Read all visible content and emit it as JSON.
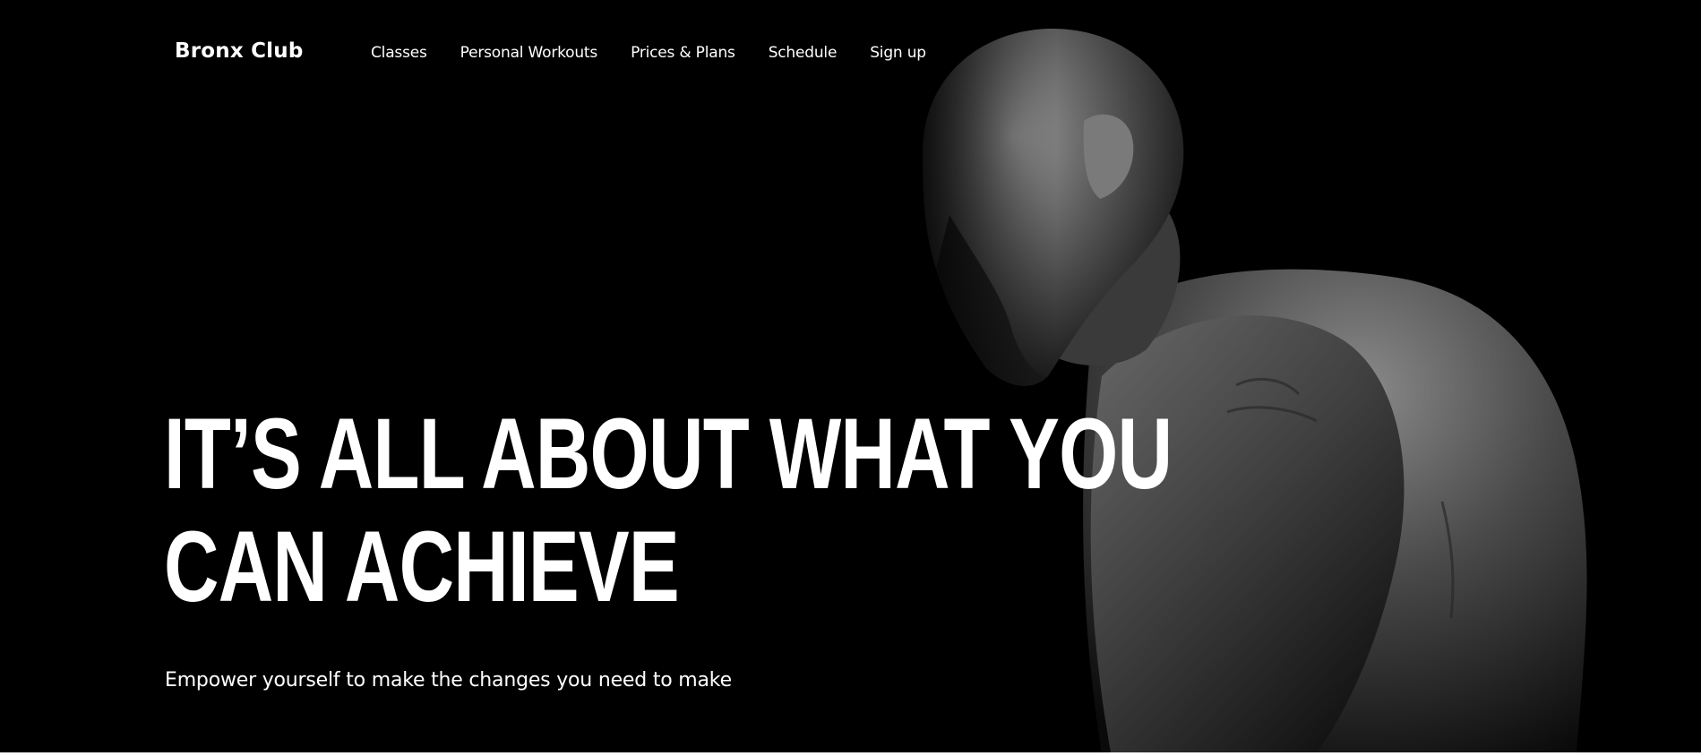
{
  "brand": {
    "name": "Bronx Club"
  },
  "nav": {
    "items": [
      {
        "label": "Classes"
      },
      {
        "label": "Personal Workouts"
      },
      {
        "label": "Prices & Plans"
      },
      {
        "label": "Schedule"
      },
      {
        "label": "Sign up"
      }
    ]
  },
  "hero": {
    "headline_line1": "IT’S ALL ABOUT WHAT YOU",
    "headline_line2": "CAN ACHIEVE",
    "tagline": "Empower yourself to make the changes you need to make",
    "image": "monochrome-athlete-portrait"
  },
  "colors": {
    "background": "#000000",
    "text": "#ffffff"
  }
}
